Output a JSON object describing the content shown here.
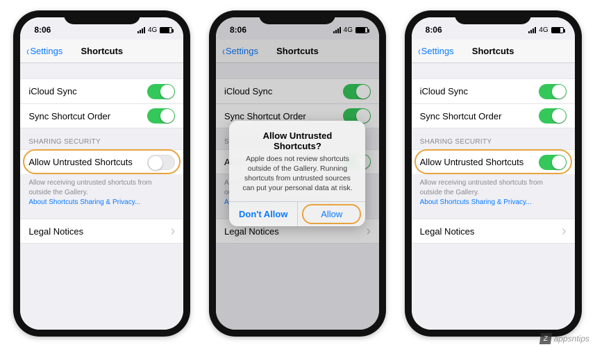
{
  "statusbar": {
    "time": "8:06",
    "network": "4G"
  },
  "nav": {
    "back": "Settings",
    "title": "Shortcuts"
  },
  "rows": {
    "icloud": "iCloud Sync",
    "order": "Sync Shortcut Order",
    "allow": "Allow Untrusted Shortcuts",
    "legal": "Legal Notices"
  },
  "groupHeader": "SHARING SECURITY",
  "footer": {
    "text": "Allow receiving untrusted shortcuts from outside the Gallery.",
    "link": "About Shortcuts Sharing & Privacy..."
  },
  "phones": [
    {
      "allowOn": false,
      "highlightRow": true,
      "showAlert": false
    },
    {
      "allowOn": true,
      "highlightRow": false,
      "showAlert": true
    },
    {
      "allowOn": true,
      "highlightRow": true,
      "showAlert": false
    }
  ],
  "alert": {
    "title": "Allow Untrusted Shortcuts?",
    "message": "Apple does not review shortcuts outside of the Gallery. Running shortcuts from untrusted sources can put your personal data at risk.",
    "dontAllow": "Don't Allow",
    "allow": "Allow"
  },
  "watermark": "appsntips"
}
